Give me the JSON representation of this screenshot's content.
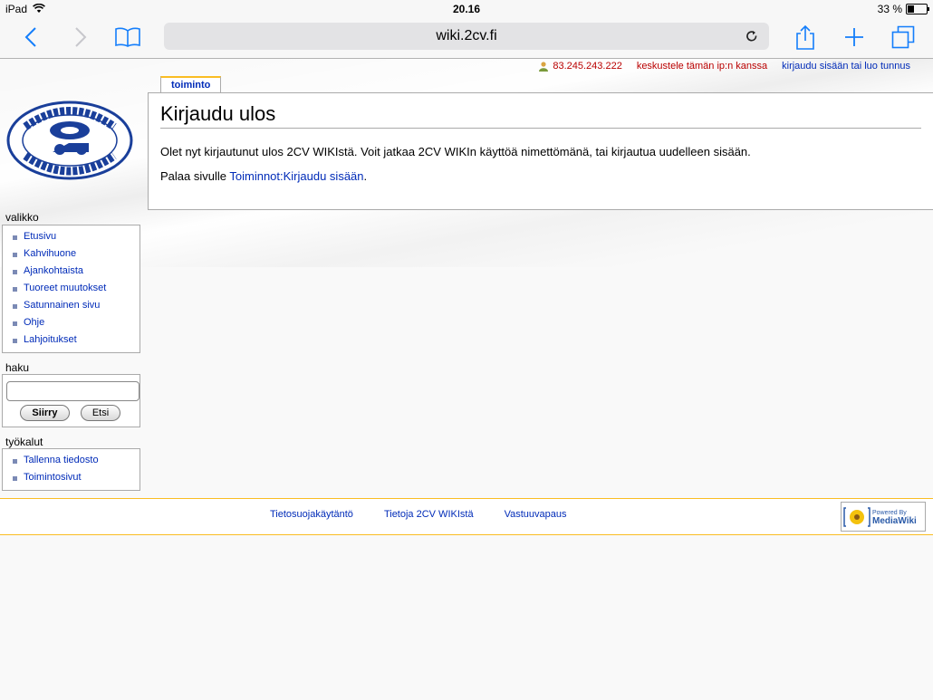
{
  "statusbar": {
    "device": "iPad",
    "time": "20.16",
    "battery": "33 %",
    "battery_level": 0.33
  },
  "browser": {
    "url": "wiki.2cv.fi",
    "icons": [
      "back-icon",
      "forward-icon",
      "bookmarks-icon",
      "reload-icon",
      "share-icon",
      "new-tab-icon",
      "tabs-icon"
    ]
  },
  "personal": {
    "ip": "83.245.243.222",
    "talk": "keskustele tämän ip:n kanssa",
    "login": "kirjaudu sisään tai luo tunnus"
  },
  "tabs": [
    "toiminto"
  ],
  "content": {
    "title": "Kirjaudu ulos",
    "p1": "Olet nyt kirjautunut ulos 2CV WIKIstä. Voit jatkaa 2CV WIKIn käyttöä nimettömänä, tai kirjautua uudelleen sisään.",
    "p2_prefix": "Palaa sivulle ",
    "p2_link": "Toiminnot:Kirjaudu sisään",
    "p2_suffix": "."
  },
  "sidebar": {
    "nav_title": "valikko",
    "nav_items": [
      "Etusivu",
      "Kahvihuone",
      "Ajankohtaista",
      "Tuoreet muutokset",
      "Satunnainen sivu",
      "Ohje",
      "Lahjoitukset"
    ],
    "search_title": "haku",
    "search_value": "",
    "go_label": "Siirry",
    "search_label": "Etsi",
    "tools_title": "työkalut",
    "tools_items": [
      "Tallenna tiedosto",
      "Toimintosivut"
    ]
  },
  "footer": {
    "links": [
      "Tietosuojakäytäntö",
      "Tietoja 2CV WIKIstä",
      "Vastuuvapaus"
    ],
    "powered_small": "Powered By",
    "powered_big": "MediaWiki"
  },
  "colors": {
    "link": "#002bb8",
    "new_link": "#ba0000",
    "safari_blue": "#147efb",
    "tab_accent": "#fabd23"
  }
}
